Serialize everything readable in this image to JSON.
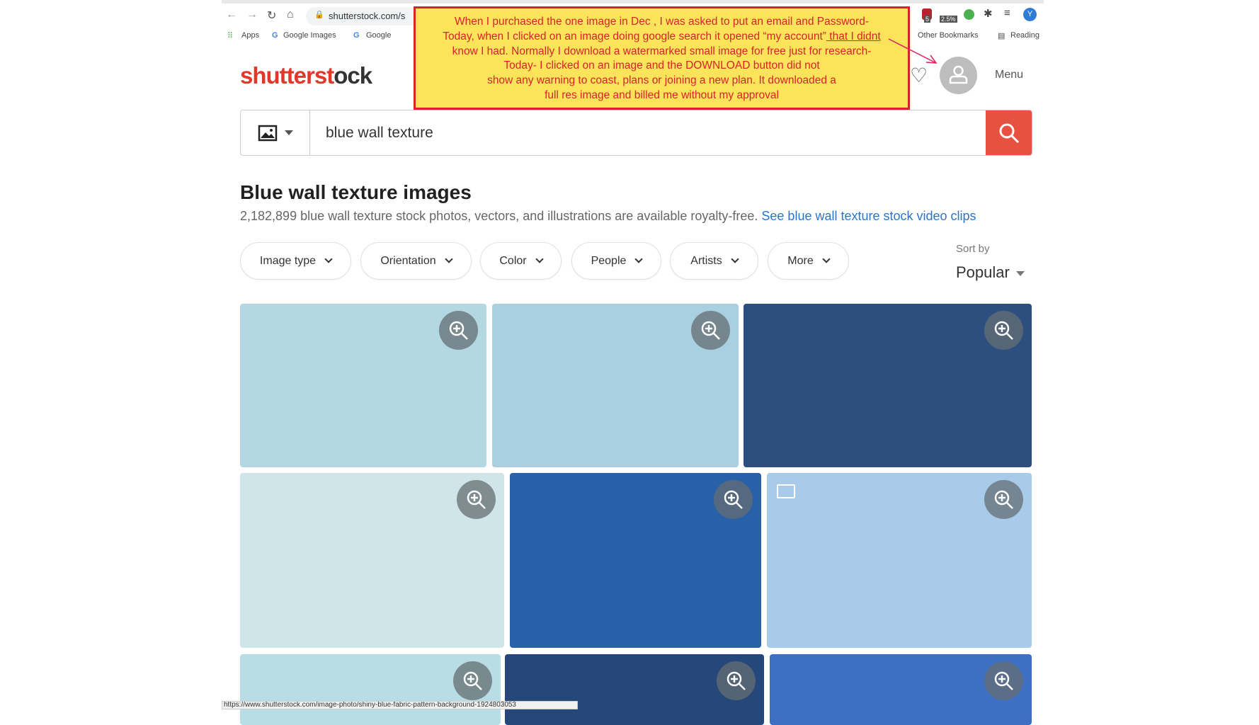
{
  "browser": {
    "url": "shutterstock.com/s",
    "bookmarks": [
      "Apps",
      "Google Images",
      "Google",
      "Other Bookmarks",
      "Reading"
    ],
    "extension_badges": [
      "5",
      "2.5%"
    ],
    "profile_initial": "Y",
    "status_url": "https://www.shutterstock.com/image-photo/shiny-blue-fabric-pattern-background-1924803053"
  },
  "header": {
    "logo": "shutterstock",
    "menu_label": "Menu"
  },
  "annotation": {
    "lines": [
      "When I purchased the one image in Dec , I was asked to put an email and Password-",
      "Today, when I clicked on an image doing google search it opened “my account”",
      " that I didnt",
      "know I had. Normally I download a watermarked small image for free just for research-",
      "Today- I clicked on an image and the DOWNLOAD button did not",
      "show any warning to coast, plans or joining a new plan. It downloaded a",
      "full res image and billed me without my approval"
    ],
    "color": "#d9232c",
    "background": "#fbe35a"
  },
  "search": {
    "value": "blue wall texture"
  },
  "results": {
    "title": "Blue wall texture images",
    "summary": "2,182,899 blue wall texture stock photos, vectors, and illustrations are available royalty-free.",
    "video_link": "See blue wall texture stock video clips"
  },
  "filters": [
    "Image type",
    "Orientation",
    "Color",
    "People",
    "Artists",
    "More"
  ],
  "sort": {
    "label": "Sort by",
    "value": "Popular"
  },
  "tiles": [
    {
      "color": "#b3d8e3"
    },
    {
      "color": "#a9d0e1"
    },
    {
      "color": "#2d4f7f"
    },
    {
      "color": "#cfe5e7"
    },
    {
      "color": "#2861a8"
    },
    {
      "color": "#a9cbea"
    },
    {
      "color": "#b9dde4"
    },
    {
      "color": "#26477a"
    },
    {
      "color": "#3d70c2"
    }
  ],
  "colors": {
    "brand": "#e2372a",
    "search_button": "#e8513f",
    "link": "#2b74c7"
  }
}
